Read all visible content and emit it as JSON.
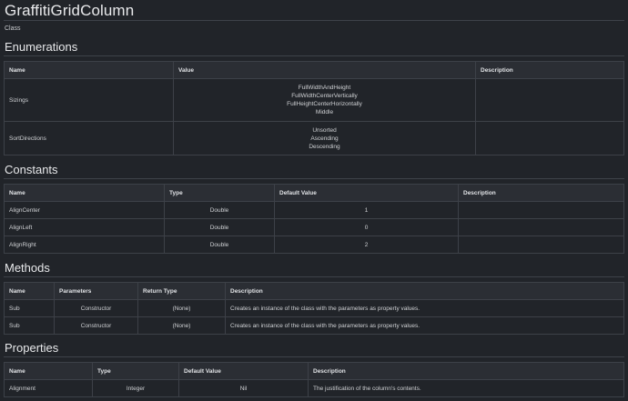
{
  "page": {
    "title": "GraffitiGridColumn",
    "kind": "Class"
  },
  "enumerations": {
    "heading": "Enumerations",
    "columns": [
      "Name",
      "Value",
      "Description"
    ],
    "rows": [
      {
        "name": "Sizings",
        "values": [
          "FullWidthAndHeight",
          "FullWidthCenterVertically",
          "FullHeightCenterHorizontally",
          "Middle"
        ],
        "description": ""
      },
      {
        "name": "SortDirections",
        "values": [
          "Unsorted",
          "Ascending",
          "Descending"
        ],
        "description": ""
      }
    ]
  },
  "constants": {
    "heading": "Constants",
    "columns": [
      "Name",
      "Type",
      "Default Value",
      "Description"
    ],
    "rows": [
      {
        "name": "AlignCenter",
        "type": "Double",
        "default": "1",
        "description": ""
      },
      {
        "name": "AlignLeft",
        "type": "Double",
        "default": "0",
        "description": ""
      },
      {
        "name": "AlignRight",
        "type": "Double",
        "default": "2",
        "description": ""
      }
    ]
  },
  "methods": {
    "heading": "Methods",
    "columns": [
      "Name",
      "Parameters",
      "Return Type",
      "Description"
    ],
    "rows": [
      {
        "name": "Sub",
        "parameters": "Constructor",
        "return_type": "(None)",
        "description": "Creates an instance of the class with the parameters as property values."
      },
      {
        "name": "Sub",
        "parameters": "Constructor",
        "return_type": "(None)",
        "description": "Creates an instance of the class with the parameters as property values."
      }
    ]
  },
  "properties": {
    "heading": "Properties",
    "columns": [
      "Name",
      "Type",
      "Default Value",
      "Description"
    ],
    "rows": [
      {
        "name": "Alignment",
        "type": "Integer",
        "default": "Nil",
        "description": "The justification of the column's contents."
      }
    ]
  }
}
